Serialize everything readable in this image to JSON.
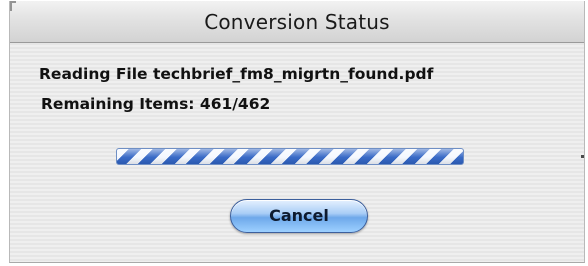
{
  "dialog": {
    "title": "Conversion Status",
    "status_line": "Reading File techbrief_fm8_migrtn_found.pdf",
    "remaining_line": "Remaining Items:  461/462",
    "progress": {
      "state": "indeterminate",
      "accent": "#2f63c4"
    },
    "cancel_label": "Cancel"
  }
}
